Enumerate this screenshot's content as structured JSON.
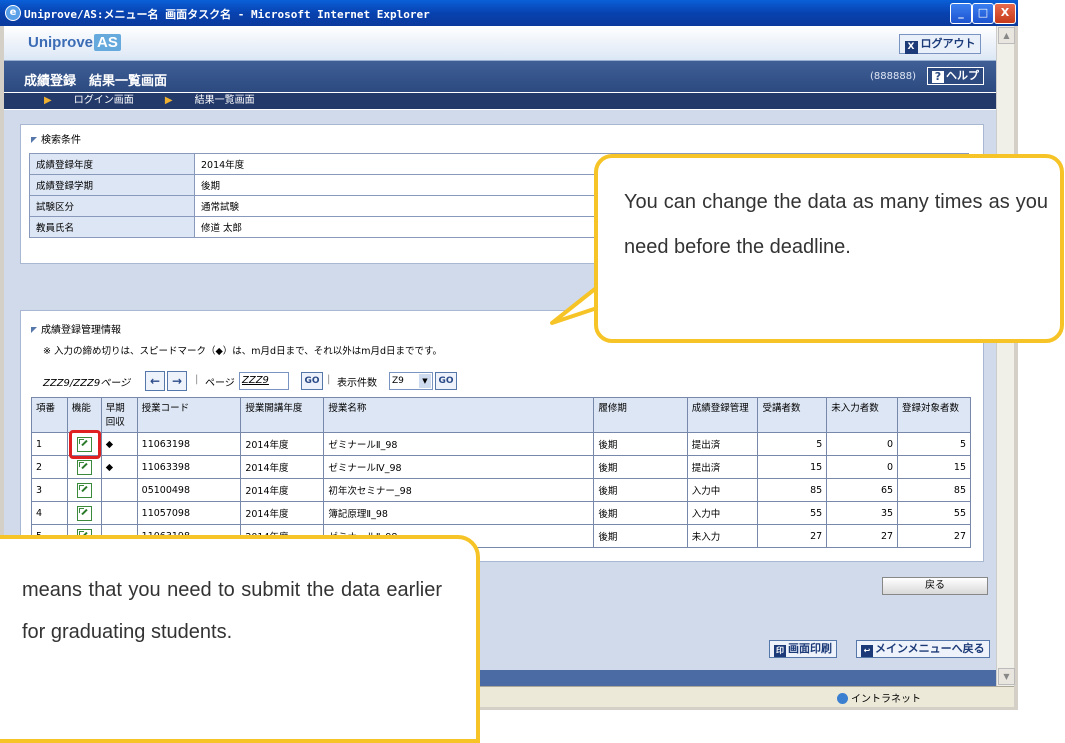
{
  "window": {
    "title": "Uniprove/AS:メニュー名 画面タスク名 - Microsoft Internet Explorer",
    "controls": {
      "minimize": "_",
      "maximize": "□",
      "close": "X"
    }
  },
  "header": {
    "logo_main": "Uniprove",
    "logo_sub": "AS",
    "logout_icon": "X",
    "logout_label": "ログアウト"
  },
  "titlebar": {
    "page_title": "成績登録　結果一覧画面",
    "user_id": "(888888)",
    "help_icon": "?",
    "help_label": "ヘルプ"
  },
  "breadcrumb": [
    "ログイン画面",
    "結果一覧画面"
  ],
  "search_panel": {
    "title": "検索条件",
    "rows": [
      {
        "key": "成績登録年度",
        "value": "2014年度"
      },
      {
        "key": "成績登録学期",
        "value": "後期"
      },
      {
        "key": "試験区分",
        "value": "通常試験"
      },
      {
        "key": "教員氏名",
        "value": "修道 太郎"
      }
    ]
  },
  "manage_panel": {
    "title": "成績登録管理情報",
    "note": "※ 入力の締め切りは、スピードマーク（◆）は、m月d日まで、それ以外はm月d日までです。",
    "pager": {
      "page_count": "ZZZ9/ZZZ9ページ",
      "prev": "←",
      "next": "→",
      "page_label": "ページ",
      "page_value": "ZZZ9",
      "go": "GO",
      "per_page_label": "表示件数",
      "per_page_value": "Z9",
      "go2": "GO"
    },
    "columns": [
      "項番",
      "機能",
      "早期回収",
      "授業コード",
      "授業開講年度",
      "授業名称",
      "履修期",
      "成績登録管理",
      "受講者数",
      "未入力者数",
      "登録対象者数"
    ],
    "rows": [
      {
        "no": "1",
        "early": "◆",
        "code": "11063198",
        "year": "2014年度",
        "name": "ゼミナールⅡ_98",
        "term": "後期",
        "status": "提出済",
        "enrolled": "5",
        "missing": "0",
        "target": "5"
      },
      {
        "no": "2",
        "early": "◆",
        "code": "11063398",
        "year": "2014年度",
        "name": "ゼミナールⅣ_98",
        "term": "後期",
        "status": "提出済",
        "enrolled": "15",
        "missing": "0",
        "target": "15"
      },
      {
        "no": "3",
        "early": "",
        "code": "05100498",
        "year": "2014年度",
        "name": "初年次セミナー_98",
        "term": "後期",
        "status": "入力中",
        "enrolled": "85",
        "missing": "65",
        "target": "85"
      },
      {
        "no": "4",
        "early": "",
        "code": "11057098",
        "year": "2014年度",
        "name": "簿記原理Ⅱ_98",
        "term": "後期",
        "status": "入力中",
        "enrolled": "55",
        "missing": "35",
        "target": "55"
      },
      {
        "no": "5",
        "early": "",
        "code": "11063198",
        "year": "2014年度",
        "name": "ゼミナールⅡ_98",
        "term": "後期",
        "status": "未入力",
        "enrolled": "27",
        "missing": "27",
        "target": "27"
      }
    ]
  },
  "buttons": {
    "back": "戻る",
    "print_icon": "印",
    "print": "画面印刷",
    "main_menu_icon": "↩",
    "main_menu": "メインメニューへ戻る"
  },
  "statusbar": {
    "zone": "イントラネット"
  },
  "callouts": {
    "deadline": "You can change the data as many times as you need before the deadline.",
    "early": "means that you need to submit the data earlier for graduating students."
  },
  "colors": {
    "accent": "#2c4a80",
    "callout_border": "#f6c426",
    "highlight": "#e02020"
  }
}
